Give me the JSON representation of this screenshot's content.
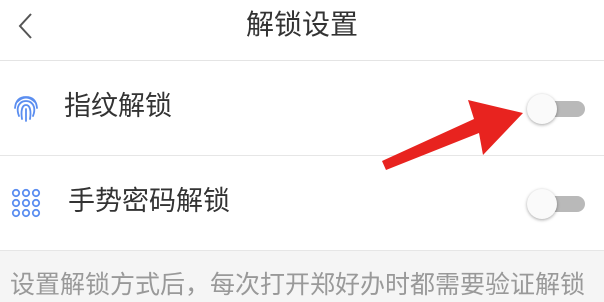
{
  "header": {
    "back_icon": "chevron-left-icon",
    "title": "解锁设置"
  },
  "rows": [
    {
      "icon": "fingerprint-icon",
      "icon_color": "#5b8ef0",
      "label": "指纹解锁",
      "enabled": false
    },
    {
      "icon": "dot-grid-icon",
      "icon_color": "#5b8ef0",
      "label": "手势密码解锁",
      "enabled": false
    }
  ],
  "hint": "设置解锁方式后，每次打开郑好办时都需要验证解锁",
  "annotation": {
    "arrow_color": "#e8231f"
  },
  "colors": {
    "toggle_off_track": "#b9b9b9",
    "toggle_knob": "#fafafa",
    "background": "#f5f5f5"
  }
}
